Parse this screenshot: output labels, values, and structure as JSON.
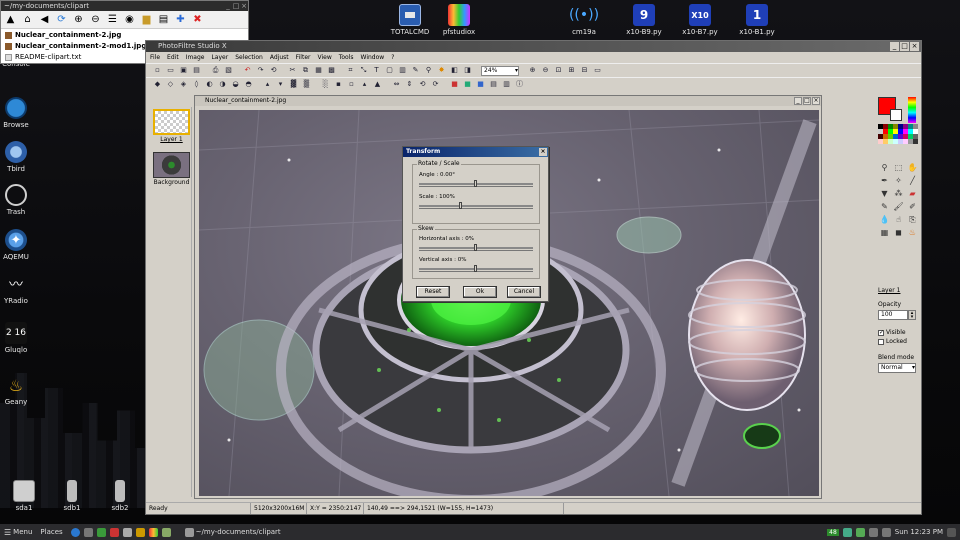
{
  "desktop": {
    "left_icons": [
      {
        "label": "Console",
        "icon": "terminal-icon"
      },
      {
        "label": "Browse",
        "icon": "globe-icon"
      },
      {
        "label": "Tbird",
        "icon": "thunderbird-icon"
      },
      {
        "label": "Trash",
        "icon": "trash-icon"
      },
      {
        "label": "AQEMU",
        "icon": "aqemu-icon"
      },
      {
        "label": "YRadio",
        "icon": "radio-icon"
      },
      {
        "label": "Gluqlo",
        "icon": "clock-icon",
        "glyph": "2 16"
      },
      {
        "label": "Geany",
        "icon": "geany-lamp-icon"
      }
    ],
    "drives": [
      {
        "label": "sda1"
      },
      {
        "label": "sdb1"
      },
      {
        "label": "sdb2"
      }
    ],
    "top_icons": [
      {
        "label": "TOTALCMD",
        "icon": "floppy-icon"
      },
      {
        "label": "pfstudiox",
        "icon": "pfstudio-icon"
      },
      {
        "label": "cm19a",
        "icon": "wireless-icon"
      },
      {
        "label": "x10-B9.py",
        "icon": "x10-b9-icon",
        "glyph": "9"
      },
      {
        "label": "x10-B7.py",
        "icon": "x10-b7-icon",
        "glyph": "X10"
      },
      {
        "label": "x10-B1.py",
        "icon": "x10-b1-icon",
        "glyph": "1"
      }
    ]
  },
  "file_manager": {
    "title": "~/my-documents/clipart",
    "files": [
      {
        "name": "Nuclear_containment-2.jpg",
        "bold": true
      },
      {
        "name": "Nuclear_containment-2-mod1.jpg",
        "bold": true
      },
      {
        "name": "README-clipart.txt",
        "bold": false
      }
    ]
  },
  "photofiltre": {
    "title": "PhotoFiltre Studio X",
    "menu": [
      "File",
      "Edit",
      "Image",
      "Layer",
      "Selection",
      "Adjust",
      "Filter",
      "View",
      "Tools",
      "Window",
      "?"
    ],
    "zoom": "24%",
    "document_title": "Nuclear_containment-2.jpg",
    "layers": [
      {
        "label": "Layer 1"
      },
      {
        "label": "Background"
      }
    ],
    "panel": {
      "layer_name": "Layer 1",
      "opacity_label": "Opacity",
      "opacity_value": "100",
      "visible_label": "Visible",
      "visible_checked": true,
      "locked_label": "Locked",
      "locked_checked": false,
      "blend_label": "Blend mode",
      "blend_value": "Normal",
      "fg_color": "#ff0000",
      "bg_color": "#ffffff"
    },
    "status": {
      "ready": "Ready",
      "size": "5120x3200x16M",
      "coords": "X:Y = 2350:2147",
      "selection": "140,49 ==> 294,1521 (W=155, H=1473)"
    }
  },
  "dialog": {
    "title": "Transform",
    "rotate_group": "Rotate / Scale",
    "angle_label": "Angle : 0.00°",
    "angle_pos": 0.5,
    "scale_label": "Scale : 100%",
    "scale_pos": 0.36,
    "skew_group": "Skew",
    "hskew_label": "Horizontal axis : 0%",
    "hskew_pos": 0.5,
    "vskew_label": "Vertical axis : 0%",
    "vskew_pos": 0.5,
    "buttons": {
      "reset": "Reset",
      "ok": "Ok",
      "cancel": "Cancel"
    }
  },
  "taskbar": {
    "menu": "Menu",
    "places": "Places",
    "task": "~/my-documents/clipart",
    "tray_badge": "48",
    "clock": "Sun 12:23 PM"
  }
}
